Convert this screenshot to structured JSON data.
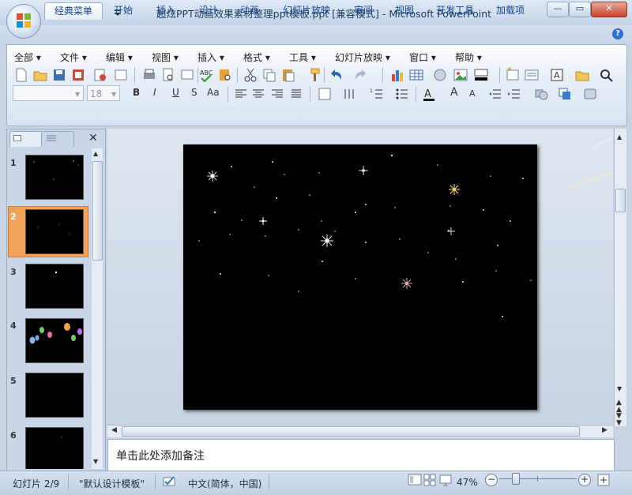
{
  "titlebar": {
    "title": "超炫PPT动画效果素材整理ppt模板.ppt [兼容模式] - Microsoft PowerPoint",
    "qat": [
      "save-icon",
      "undo-icon",
      "redo-icon",
      "customize-icon"
    ]
  },
  "tabs": [
    {
      "label": "经典菜单",
      "active": true
    },
    {
      "label": "开始"
    },
    {
      "label": "插入"
    },
    {
      "label": "设计"
    },
    {
      "label": "动画"
    },
    {
      "label": "幻灯片放映"
    },
    {
      "label": "审阅"
    },
    {
      "label": "视图"
    },
    {
      "label": "开发工具"
    },
    {
      "label": "加载项"
    }
  ],
  "menus": [
    "全部",
    "文件",
    "编辑",
    "视图",
    "插入",
    "格式",
    "工具",
    "幻灯片放映",
    "窗口",
    "帮助"
  ],
  "format": {
    "font_size": "18",
    "bold": "B",
    "italic": "I",
    "underline": "U",
    "shadow": "S",
    "case": "Aa",
    "font_grow": "A",
    "font_shrink": "A"
  },
  "slides_panel": {
    "slides": [
      {
        "num": "1"
      },
      {
        "num": "2",
        "selected": true
      },
      {
        "num": "3"
      },
      {
        "num": "4"
      },
      {
        "num": "5"
      },
      {
        "num": "6"
      }
    ]
  },
  "notes": {
    "placeholder": "单击此处添加备注"
  },
  "status": {
    "slide": "幻灯片 2/9",
    "theme": "\"默认设计模板\"",
    "language": "中文(简体，中国)",
    "zoom": "47%"
  },
  "colors": {
    "accent": "#15428b",
    "selected_thumb": "#f0a35a",
    "slide_bg": "#000000"
  }
}
